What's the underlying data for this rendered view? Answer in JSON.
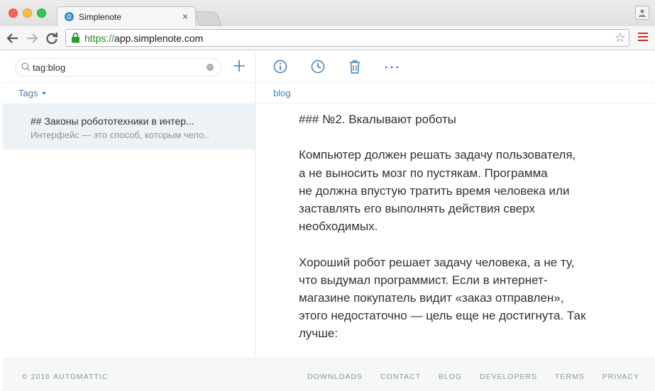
{
  "browser": {
    "tab_title": "Simplenote",
    "url_scheme": "https://",
    "url_rest": "app.simplenote.com",
    "accent_secure": "#1e8a1e"
  },
  "sidebar": {
    "search_value": "tag:blog",
    "tags_label": "Tags",
    "notes": [
      {
        "title": "## Законы робототехники в интер...",
        "excerpt": "Интерфейс — это способ, которым чело.."
      }
    ]
  },
  "editor": {
    "tag": "blog",
    "lines": [
      "### №2. Вкалывают роботы",
      "",
      "Компьютер должен решать задачу пользователя,",
      "а не выносить мозг по пустякам. Программа",
      "не должна впустую тратить время человека или",
      "заставлять его выполнять действия сверх",
      "необходимых.",
      "",
      "Хороший робот решает задачу человека, а не ту,",
      "что выдумал программист. Если в интернет-",
      "магазине покупатель видит «заказ отправлен»,",
      "этого недостаточно — цель еще не достигнута. Так",
      "лучше:"
    ]
  },
  "footer": {
    "copyright": "© 2016",
    "brand": "AUTOMATTIC",
    "links": [
      "DOWNLOADS",
      "CONTACT",
      "BLOG",
      "DEVELOPERS",
      "TERMS",
      "PRIVACY"
    ]
  },
  "colors": {
    "accent": "#3b7fb8",
    "selected_note_bg": "#edf2f6"
  }
}
